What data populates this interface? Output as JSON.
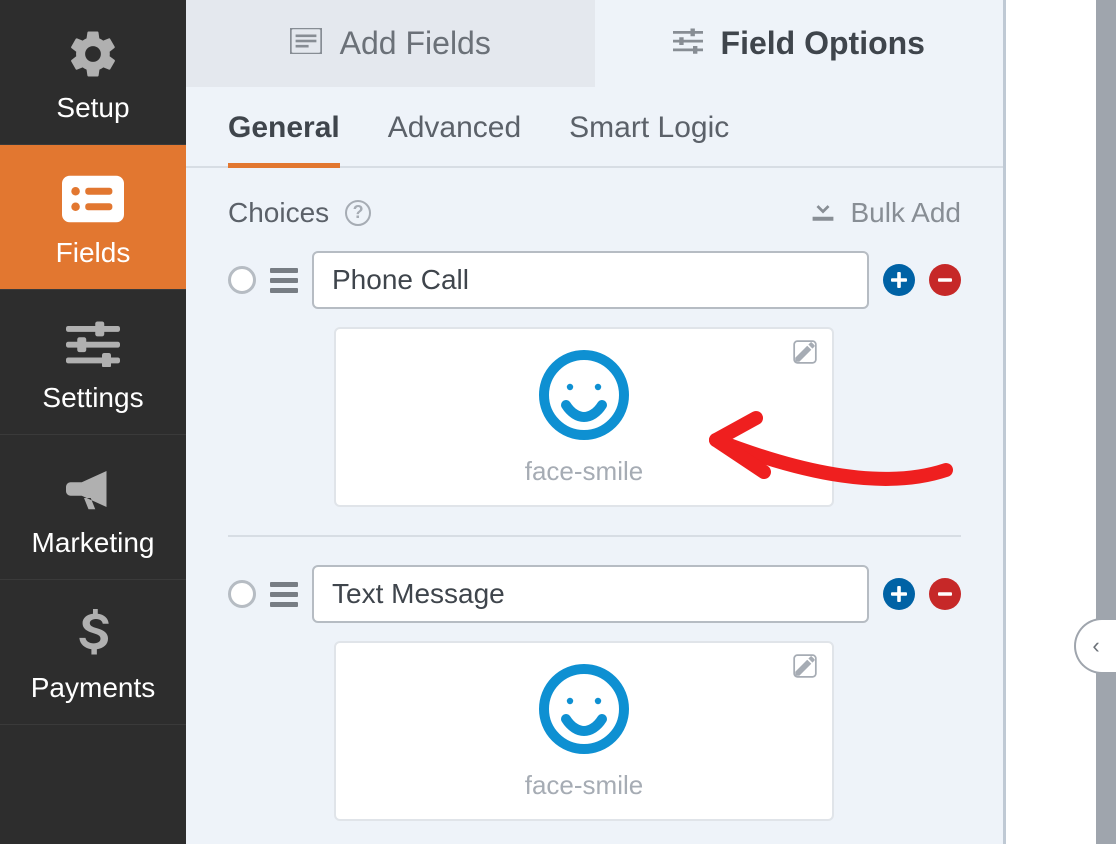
{
  "sidebar": {
    "items": [
      {
        "label": "Setup"
      },
      {
        "label": "Fields"
      },
      {
        "label": "Settings"
      },
      {
        "label": "Marketing"
      },
      {
        "label": "Payments"
      }
    ]
  },
  "topTabs": {
    "add_fields": "Add Fields",
    "field_options": "Field Options"
  },
  "subTabs": {
    "general": "General",
    "advanced": "Advanced",
    "smart_logic": "Smart Logic"
  },
  "section": {
    "title": "Choices",
    "bulk_add": "Bulk Add"
  },
  "choices": [
    {
      "value": "Phone Call",
      "icon_label": "face-smile"
    },
    {
      "value": "Text Message",
      "icon_label": "face-smile"
    }
  ],
  "collapse_chevron": "‹"
}
